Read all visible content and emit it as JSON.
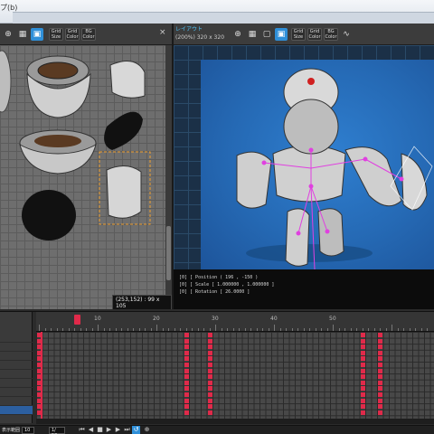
{
  "window": {
    "title": "プ(b)"
  },
  "layout_panel": {
    "title": "レイアウト",
    "size": "(200%) 320 x 320"
  },
  "atlas": {
    "cursor_coord": "(253,152) : 99 x 105"
  },
  "toolbar": {
    "grid_label": "Grid",
    "size_label": "Size",
    "color_label": "Color",
    "bg_label": "BG",
    "close_glyph": "×"
  },
  "console_lines": [
    "[0] [ Position ( 196 , -150 )",
    "[0] [ Scale [ 1.000000 , 1.000000 ]",
    "[0] [ Rotation [ 26.0000 ]"
  ],
  "timeline": {
    "ruler_labels": [
      "10",
      "20",
      "30",
      "40",
      "50"
    ],
    "key_columns": [
      0,
      25,
      29,
      55,
      58
    ],
    "rows": 14
  },
  "status": {
    "frame_label": "表示範囲",
    "start": "10",
    "end": "1/  50"
  },
  "colors": {
    "accent": "#2f8fd8",
    "key": "#e02a4a",
    "canvas": "#2569b4"
  },
  "icons": [
    "zoom-icon",
    "grid-icon",
    "select-icon",
    "play-icon",
    "loop-icon"
  ]
}
